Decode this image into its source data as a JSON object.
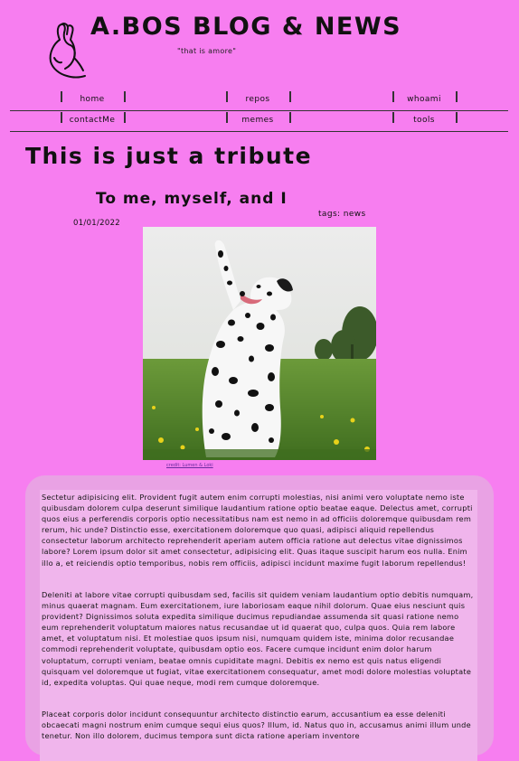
{
  "site": {
    "title": "A.BOS BLOG & NEWS",
    "tagline": "\"that is amore\""
  },
  "nav": {
    "row1": [
      "home",
      "repos",
      "whoami"
    ],
    "row2": [
      "contactMe",
      "memes",
      "tools"
    ]
  },
  "page": {
    "heading": "This is just a tribute"
  },
  "post": {
    "title": "To me, myself, and I",
    "tags": "tags: news",
    "date": "01/01/2022",
    "credit": "credit: Lumen & Loki",
    "paragraphs": [
      "Sectetur adipisicing elit. Provident fugit autem enim corrupti molestias, nisi animi vero voluptate nemo iste quibusdam dolorem culpa deserunt similique laudantium ratione optio beatae eaque. Delectus amet, corrupti quos eius a perferendis corporis optio necessitatibus nam est nemo in ad officiis doloremque quibusdam rem rerum, hic unde? Distinctio esse, exercitationem doloremque quo quasi, adipisci aliquid repellendus consectetur laborum architecto reprehenderit aperiam autem officia ratione aut delectus vitae dignissimos labore? Lorem ipsum dolor sit amet consectetur, adipisicing elit. Quas itaque suscipit harum eos nulla. Enim illo a, et reiciendis optio temporibus, nobis rem officiis, adipisci incidunt maxime fugit laborum repellendus!",
      "Deleniti at labore vitae corrupti quibusdam sed, facilis sit quidem veniam laudantium optio debitis numquam, minus quaerat magnam. Eum exercitationem, iure laboriosam eaque nihil dolorum. Quae eius nesciunt quis provident? Dignissimos soluta expedita similique ducimus repudiandae assumenda sit quasi ratione nemo eum reprehenderit voluptatum maiores natus recusandae ut id quaerat quo, culpa quos. Quia rem labore amet, et voluptatum nisi. Et molestiae quos ipsum nisi, numquam quidem iste, minima dolor recusandae commodi reprehenderit voluptate, quibusdam optio eos. Facere cumque incidunt enim dolor harum voluptatum, corrupti veniam, beatae omnis cupiditate magni. Debitis ex nemo est quis natus eligendi quisquam vel doloremque ut fugiat, vitae exercitationem consequatur, amet modi dolore molestias voluptate id, expedita voluptas. Qui quae neque, modi rem cumque doloremque.",
      "Placeat corporis dolor incidunt consequuntur architecto distinctio earum, accusantium ea esse deleniti obcaecati magni nostrum enim cumque sequi eius quos? Illum, id. Natus quo in, accusamus animi illum unde tenetur. Non illo dolorem, ducimus tempora sunt dicta ratione aperiam inventore"
    ]
  },
  "colors": {
    "background": "#f77ef0",
    "content_outer": "#e9a2e4",
    "content_inner": "#f0b5ec",
    "text": "#111111",
    "link": "#6b2aa0"
  },
  "icons": {
    "logo": "italian-hand-gesture-icon"
  }
}
